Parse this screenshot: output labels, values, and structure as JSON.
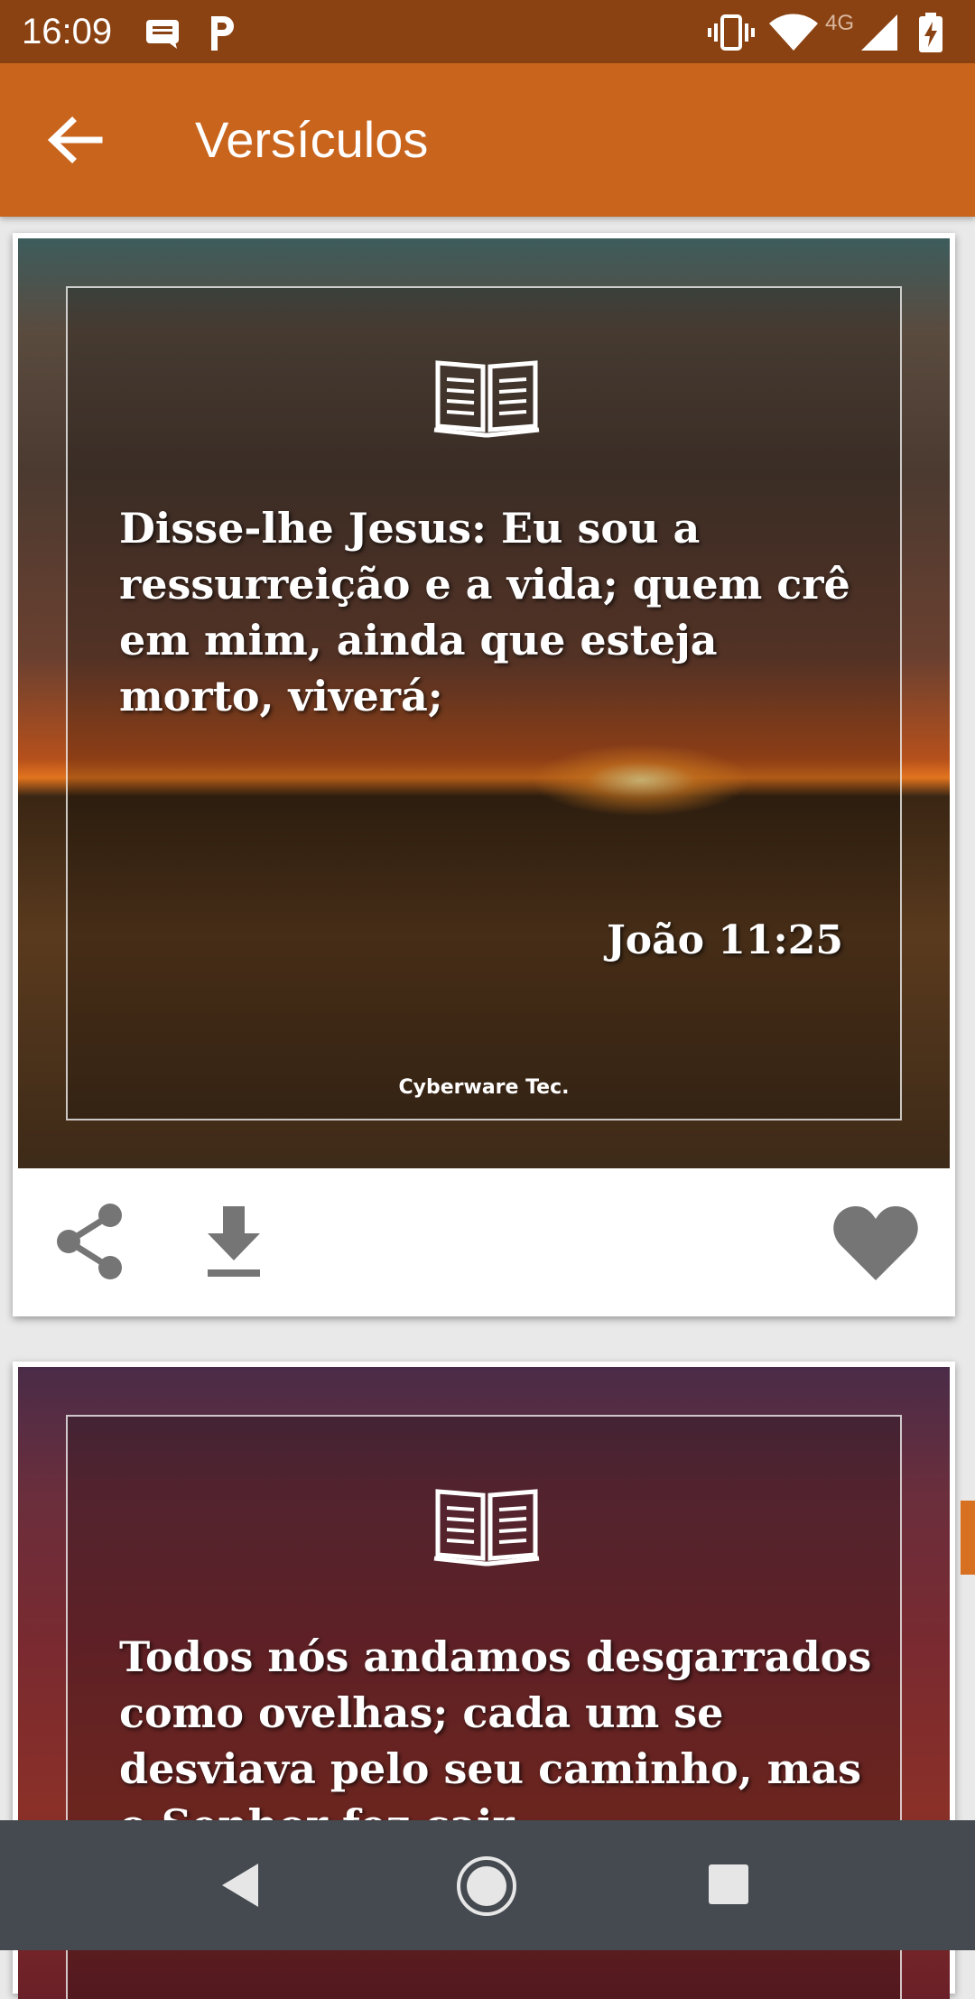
{
  "status_bar": {
    "time": "16:09",
    "network": "4G",
    "icons": [
      "message-icon",
      "parking-icon",
      "vibrate-icon",
      "wifi-icon",
      "signal-icon",
      "battery-charging-icon"
    ]
  },
  "app_bar": {
    "title": "Versículos",
    "back_icon": "arrow-back-icon"
  },
  "cards": [
    {
      "verse": "Disse-lhe Jesus: Eu sou a ressurreição e a vida; quem crê em mim, ainda que esteja morto, viverá;",
      "reference": "João 11:25",
      "watermark": "Cyberware Tec.",
      "actions": [
        "share-icon",
        "download-icon",
        "heart-icon"
      ]
    },
    {
      "verse": "Todos nós andamos desgarrados como ovelhas; cada um se desviava pelo seu caminho, mas o Senhor fez cair"
    }
  ],
  "colors": {
    "status_bar": "#8a4212",
    "app_bar": "#c9641d",
    "accent": "#d87021",
    "icon_gray": "#757575",
    "nav_bar": "#444a50"
  },
  "nav_bar": {
    "buttons": [
      "back-triangle-icon",
      "home-circle-icon",
      "recents-square-icon"
    ]
  }
}
